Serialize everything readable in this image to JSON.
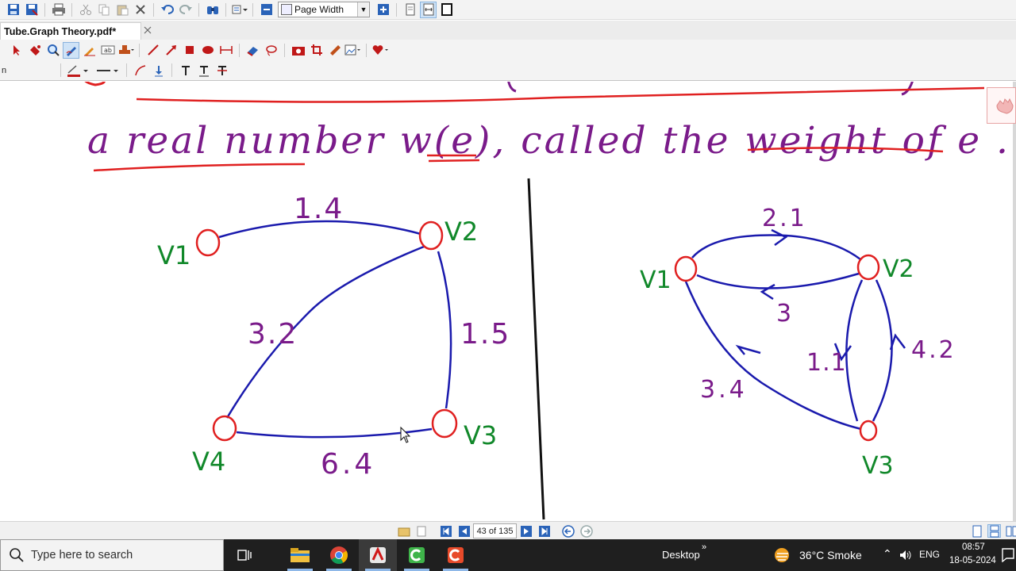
{
  "app": {
    "document_tab": "Tube.Graph Theory.pdf*",
    "zoom_mode": "Page Width",
    "tool_row3_label": "n"
  },
  "colors": {
    "accent": "#2b5fb4",
    "ink_red": "#e02020",
    "ink_purple": "#7a1b8a",
    "ink_blue": "#1a1aad",
    "ink_green": "#11882a",
    "taskbar": "#1f1f1f"
  },
  "toolbar_row1_icons": [
    "save-icon",
    "save-as-icon",
    "print-icon",
    "cut-icon",
    "copy-icon",
    "paste-icon",
    "delete-icon",
    "undo-icon",
    "redo-icon",
    "find-icon",
    "options-icon",
    "zoom-out-icon",
    "zoom-in-icon",
    "single-page-icon",
    "fit-page-icon",
    "fullscreen-icon"
  ],
  "toolbar_row2_icons": [
    "select-arrow-icon",
    "hand-tool-icon",
    "zoom-tool-icon",
    "pen-tool-icon",
    "highlighter-icon",
    "textbox-icon",
    "stamp-icon",
    "line-tool-icon",
    "arrow-tool-icon",
    "rectangle-tool-icon",
    "ellipse-tool-icon",
    "measure-tool-icon",
    "eraser-icon",
    "lasso-icon",
    "snapshot-icon",
    "crop-icon",
    "ruler-icon",
    "add-image-icon",
    "favorite-heart-icon"
  ],
  "toolbar_row3_icons": [
    "line-color-icon",
    "line-width-icon",
    "curve-tool-icon",
    "insert-below-icon",
    "text-tool-icon",
    "text-baseline-icon",
    "strikeout-icon"
  ],
  "note": {
    "line1": "a real number w(e), called the weight of e .",
    "graph_left": {
      "vertices": [
        "V1",
        "V2",
        "V3",
        "V4"
      ],
      "edge_weights": [
        "1.4",
        "3.2",
        "1.5",
        "6.4"
      ]
    },
    "graph_right": {
      "vertices": [
        "V1",
        "V2",
        "V3"
      ],
      "edge_weights": [
        "2.1",
        "3",
        "1.1",
        "4.2",
        "3.4"
      ]
    }
  },
  "statusbar": {
    "page_indicator": "43 of 135"
  },
  "taskbar": {
    "search_placeholder": "Type here to search",
    "desktop_label": "Desktop",
    "weather": "36°C  Smoke",
    "language": "ENG",
    "time": "08:57",
    "date": "18-05-2024"
  }
}
